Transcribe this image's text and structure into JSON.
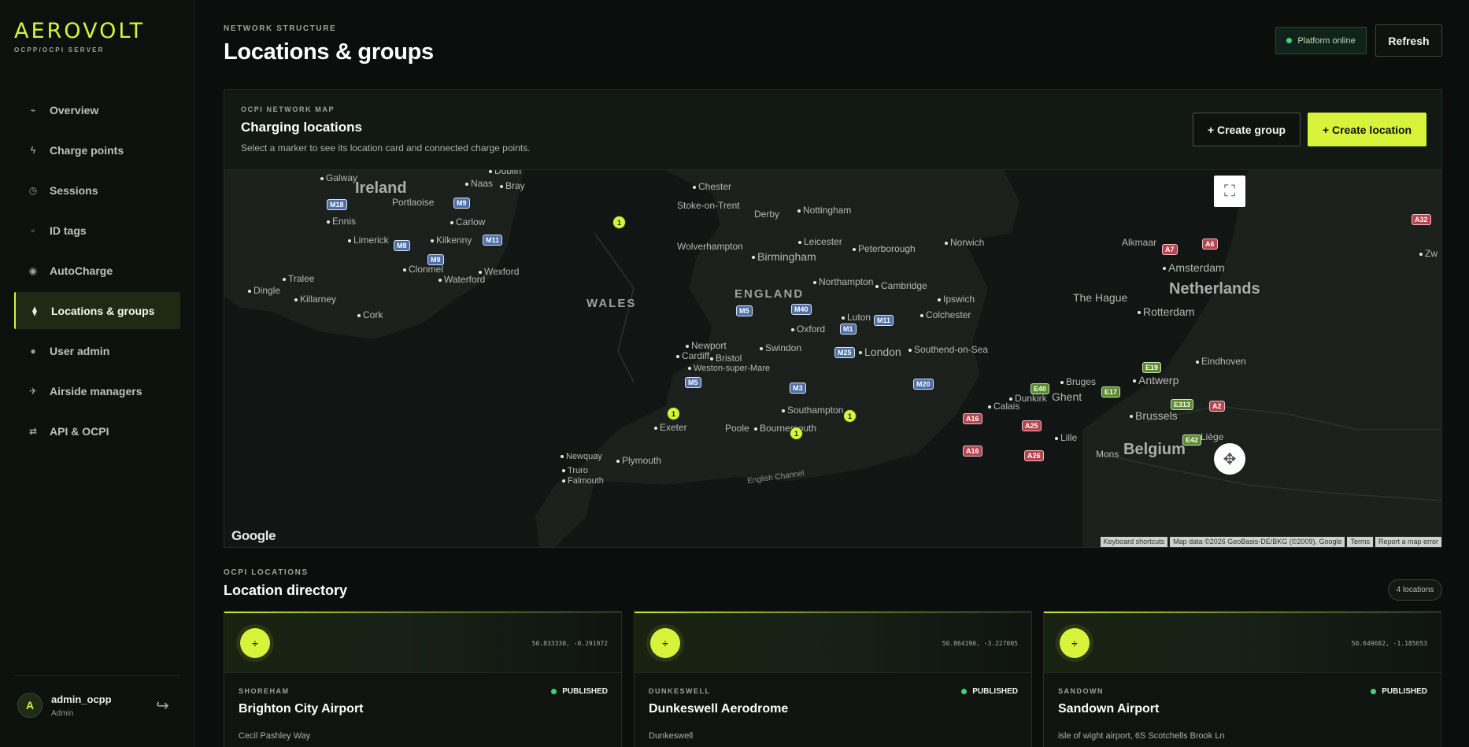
{
  "brand": {
    "name": "AEROVOLT",
    "subtitle": "OCPP/OCPI SERVER"
  },
  "nav": [
    {
      "label": "Overview",
      "icon": "pulse-icon"
    },
    {
      "label": "Charge points",
      "icon": "bolt-icon"
    },
    {
      "label": "Sessions",
      "icon": "clock-icon"
    },
    {
      "label": "ID tags",
      "icon": "tag-icon"
    },
    {
      "label": "AutoCharge",
      "icon": "target-icon"
    },
    {
      "label": "Locations & groups",
      "icon": "pin-icon",
      "active": true
    },
    {
      "label": "User admin",
      "icon": "user-icon"
    },
    {
      "label": "Airside managers",
      "icon": "plane-icon"
    },
    {
      "label": "API & OCPI",
      "icon": "swap-icon"
    }
  ],
  "user": {
    "initial": "A",
    "name": "admin_ocpp",
    "role": "Admin"
  },
  "header": {
    "kicker": "NETWORK STRUCTURE",
    "title": "Locations & groups",
    "status": "Platform online",
    "refresh": "Refresh"
  },
  "map_panel": {
    "kicker": "OCPI NETWORK MAP",
    "title": "Charging locations",
    "description": "Select a marker to see its location card and connected charge points.",
    "create_group": "+ Create group",
    "create_location": "+ Create location"
  },
  "map": {
    "labels": {
      "ireland": "Ireland",
      "wales": "WALES",
      "england": "ENGLAND",
      "netherlands": "Netherlands",
      "belgium": "Belgium",
      "galway": "Galway",
      "naas": "Naas",
      "bray": "Bray",
      "dublin": "Dublin",
      "portlaoise": "Portlaoise",
      "carlow": "Carlow",
      "ennis": "Ennis",
      "limerick": "Limerick",
      "kilkenny": "Kilkenny",
      "clonmel": "Clonmel",
      "wexford": "Wexford",
      "waterford": "Waterford",
      "tralee": "Tralee",
      "dingle": "Dingle",
      "killarney": "Killarney",
      "cork": "Cork",
      "chester": "Chester",
      "stoke": "Stoke-on-Trent",
      "derby": "Derby",
      "nottingham": "Nottingham",
      "wolverhampton": "Wolverhampton",
      "leicester": "Leicester",
      "birmingham": "Birmingham",
      "peterborough": "Peterborough",
      "norwich": "Norwich",
      "northampton": "Northampton",
      "cambridge": "Cambridge",
      "ipswich": "Ipswich",
      "luton": "Luton",
      "colchester": "Colchester",
      "oxford": "Oxford",
      "newport": "Newport",
      "cardiff": "Cardiff",
      "bristol": "Bristol",
      "swindon": "Swindon",
      "london": "London",
      "southend": "Southend-on-Sea",
      "weston": "Weston-super-Mare",
      "southampton": "Southampton",
      "exeter": "Exeter",
      "poole": "Poole",
      "bournemouth": "Bournemouth",
      "newquay": "Newquay",
      "plymouth": "Plymouth",
      "truro": "Truro",
      "falmouth": "Falmouth",
      "english_channel": "English Channel",
      "alkmaar": "Alkmaar",
      "amsterdam": "Amsterdam",
      "zw": "Zw",
      "the_hague": "The Hague",
      "rotterdam": "Rotterdam",
      "eindhoven": "Eindhoven",
      "antwerp": "Antwerp",
      "bruges": "Bruges",
      "ghent": "Ghent",
      "dunkirk": "Dunkirk",
      "calais": "Calais",
      "brussels": "Brussels",
      "lille": "Lille",
      "mons": "Mons",
      "liege": "Liège"
    },
    "roads": {
      "m18": "M18",
      "m9a": "M9",
      "m8": "M8",
      "m11a": "M11",
      "m9b": "M9",
      "m5a": "M5",
      "m40": "M40",
      "m1": "M1",
      "m11b": "M11",
      "m25": "M25",
      "m5b": "M5",
      "m3": "M3",
      "m20": "M20",
      "a7": "A7",
      "a6": "A6",
      "a32": "A32",
      "e19": "E19",
      "e40": "E40",
      "e17": "E17",
      "e313": "E313",
      "a2": "A2",
      "a16a": "A16",
      "a25": "A25",
      "e42": "E42",
      "a16b": "A16",
      "a26": "A26"
    },
    "markers": [
      "1",
      "1",
      "1",
      "1"
    ],
    "google": "Google",
    "attribution": [
      "Keyboard shortcuts",
      "Map data ©2026 GeoBasis-DE/BKG (©2009), Google",
      "Terms",
      "Report a map error"
    ]
  },
  "directory": {
    "kicker": "OCPI LOCATIONS",
    "title": "Location directory",
    "count": "4 locations",
    "cards": [
      {
        "coords": "50.833330, -0.291972",
        "city": "SHOREHAM",
        "status": "PUBLISHED",
        "name": "Brighton City Airport",
        "address": "Cecil Pashley Way"
      },
      {
        "coords": "50.864190, -3.227005",
        "city": "DUNKESWELL",
        "status": "PUBLISHED",
        "name": "Dunkeswell Aerodrome",
        "address": "Dunkeswell"
      },
      {
        "coords": "50.649682, -1.185653",
        "city": "SANDOWN",
        "status": "PUBLISHED",
        "name": "Sandown Airport",
        "address": "isle of wight airport, 6S Scotchells Brook Ln"
      }
    ]
  }
}
